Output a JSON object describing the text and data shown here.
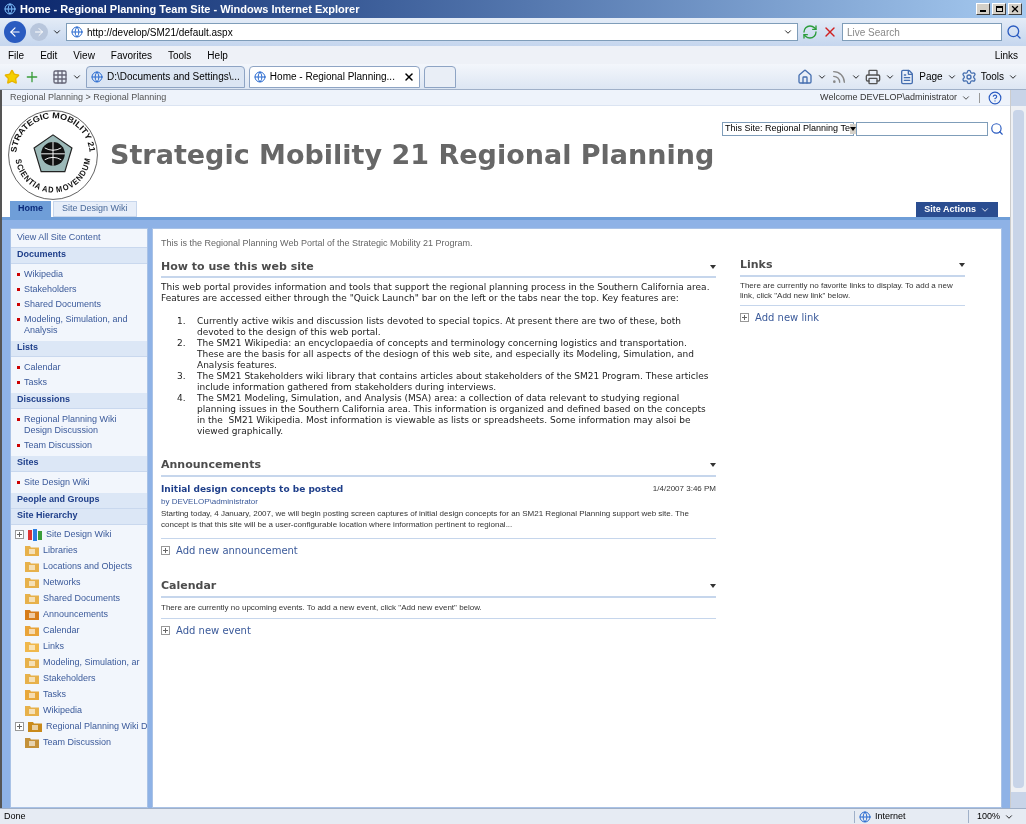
{
  "window": {
    "title": "Home - Regional Planning Team Site - Windows Internet Explorer"
  },
  "address_bar": {
    "url": "http://develop/SM21/default.aspx",
    "search_placeholder": "Live Search"
  },
  "menu": [
    "File",
    "Edit",
    "View",
    "Favorites",
    "Tools",
    "Help"
  ],
  "links_label": "Links",
  "browser_tabs": [
    {
      "label": "D:\\Documents and Settings\\...",
      "selected": false
    },
    {
      "label": "Home - Regional Planning...",
      "selected": true
    }
  ],
  "command_bar": [
    "Page",
    "Tools"
  ],
  "page": {
    "breadcrumb": "Regional Planning > Regional Planning",
    "welcome": "Welcome DEVELOP\\administrator",
    "logo": {
      "top_text": "STRATEGIC MOBILITY 21",
      "bottom_text": "SCIENTIA AD MOVENDUM"
    },
    "site_title": "Strategic Mobility 21 Regional Planning",
    "search_scope": "This Site: Regional Planning Te",
    "nav_tabs": [
      {
        "label": "Home",
        "selected": true
      },
      {
        "label": "Site Design Wiki",
        "selected": false
      }
    ],
    "site_actions": "Site Actions",
    "quick_launch": {
      "view_all": "View All Site Content",
      "sections": [
        {
          "heading": "Documents",
          "items": [
            "Wikipedia",
            "Stakeholders",
            "Shared Documents",
            "Modeling, Simulation, and Analysis"
          ]
        },
        {
          "heading": "Lists",
          "items": [
            "Calendar",
            "Tasks"
          ]
        },
        {
          "heading": "Discussions",
          "items": [
            "Regional Planning Wiki Design Discussion",
            "Team Discussion"
          ]
        },
        {
          "heading": "Sites",
          "items": [
            "Site Design Wiki"
          ]
        },
        {
          "heading": "People and Groups"
        },
        {
          "heading": "Site Hierarchy"
        }
      ],
      "tree": [
        {
          "label": "Site Design Wiki",
          "kind": "site",
          "children": [
            {
              "label": "Libraries",
              "kind": "library"
            },
            {
              "label": "Locations and Objects",
              "kind": "library"
            },
            {
              "label": "Networks",
              "kind": "library"
            },
            {
              "label": "Shared Documents",
              "kind": "library"
            },
            {
              "label": "Announcements",
              "kind": "announcements"
            },
            {
              "label": "Calendar",
              "kind": "calendar"
            },
            {
              "label": "Links",
              "kind": "links"
            },
            {
              "label": "Modeling, Simulation, ar",
              "kind": "library"
            },
            {
              "label": "Stakeholders",
              "kind": "library"
            },
            {
              "label": "Tasks",
              "kind": "tasks"
            },
            {
              "label": "Wikipedia",
              "kind": "library"
            }
          ]
        },
        {
          "label": "Regional Planning Wiki D",
          "kind": "site2",
          "children": [
            {
              "label": "Team Discussion",
              "kind": "discussion"
            }
          ]
        }
      ]
    },
    "intro": "This is the Regional Planning Web Portal of the Strategic Mobility 21 Program.",
    "how_to": {
      "title": "How to use this web site",
      "text": "This web portal provides information and tools that support the regional planning process in the Southern California area. Features are accessed either through the \"Quick Launch\" bar on the left or the tabs near the top. Key features are:",
      "list": [
        {
          "number": "1.",
          "text": "Currently active wikis and discussion lists devoted to special topics. At present there are two of these, both devoted to the design of this web portal."
        },
        {
          "number": "2.",
          "text": "The SM21 Wikipedia: an encyclopaedia of concepts and terminology concerning logistics and transportation. These are the basis for all aspects of the desiogn of this web site, and especially its Modeling, Simulation, and Analysis features."
        },
        {
          "number": "3.",
          "text": "The SM21 Stakeholders wiki library that contains articles about stakeholders of the SM21 Program. These articles include information gathered from stakeholders during interviews."
        },
        {
          "number": "4.",
          "text": "The SM21 Modeling, Simulation, and Analysis (MSA) area: a collection of data relevant to studying regional planning issues in the Southern California area. This information is organized and defined based on the concepts in the  SM21 Wikipedia. Most information is viewable as lists or spreadsheets. Some information may alsoi be viewed graphically."
        }
      ]
    },
    "announcements": {
      "title": "Announcements",
      "item": {
        "title": "Initial design concepts to be posted",
        "date": "1/4/2007 3:46 PM",
        "author": "by DEVELOP\\administrator",
        "body": "Starting today, 4 January, 2007, we will begin posting screen captures of initial design concepts for an SM21 Regional Planning support web site. The concept is that this site will be a user-configurable location where information pertinent to regional..."
      },
      "add": "Add new announcement"
    },
    "calendar": {
      "title": "Calendar",
      "empty": "There are currently no upcoming events. To add a new event, click \"Add new event\" below.",
      "add": "Add new event"
    },
    "links": {
      "title": "Links",
      "empty": "There are currently no favorite links to display. To add a new link, click \"Add new link\" below.",
      "add": "Add new link"
    }
  },
  "status_bar": {
    "text": "Done",
    "zone": "Internet",
    "zoom": "100%"
  }
}
